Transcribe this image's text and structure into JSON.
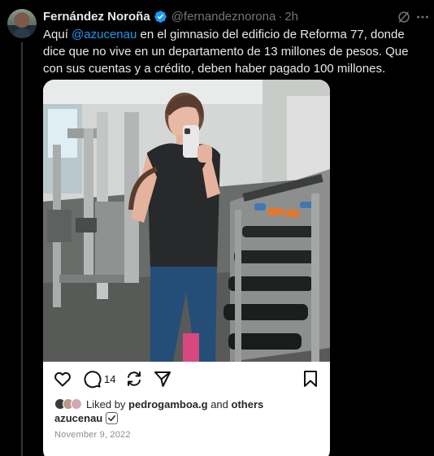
{
  "author": {
    "display_name": "Fernández Noroña",
    "handle": "@fernandeznorona",
    "separator": "·",
    "time": "2h"
  },
  "tweet": {
    "text_before": "Aquí ",
    "mention": "@azucenau",
    "text_after": " en el gimnasio del edificio de Reforma 77, donde dice que no vive en un departamento de 13 millones de pesos. Que con sus cuentas y a crédito, deben haber pagado 100 millones."
  },
  "embed": {
    "comment_count": "14",
    "liked_by_prefix": "Liked by",
    "liked_by_user": "pedrogamboa.g",
    "liked_by_middle": "and",
    "liked_by_suffix": "others",
    "username": "azucenau",
    "date": "November 9, 2022"
  },
  "icons": {
    "verified": "verified-badge-icon",
    "grok": "grok-icon",
    "more": "more-icon",
    "like": "heart-icon",
    "comment": "comment-icon",
    "share": "repost-icon",
    "send": "send-icon",
    "save": "bookmark-icon"
  },
  "colors": {
    "background": "#000000",
    "mention": "#1d9bf0",
    "verified": "#1d9bf0",
    "muted": "#71767b"
  }
}
